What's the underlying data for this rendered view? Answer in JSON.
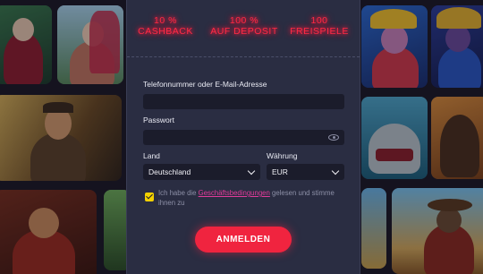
{
  "bonuses": [
    {
      "value": "10 %",
      "label": "CASHBACK"
    },
    {
      "value": "100 %",
      "label": "AUF DEPOSIT"
    },
    {
      "value": "100",
      "label": "FREISPIELE"
    }
  ],
  "form": {
    "contact_label": "Telefonnummer oder E-Mail-Adresse",
    "contact_value": "",
    "password_label": "Passwort",
    "password_value": "",
    "country_label": "Land",
    "country_value": "Deutschland",
    "currency_label": "Währung",
    "currency_value": "EUR",
    "terms_prefix": "Ich habe die ",
    "terms_link": "Geschäftsbedingungen",
    "terms_suffix": " gelesen und stimme ihnen zu",
    "terms_checked": true,
    "submit_label": "ANMELDEN"
  },
  "colors": {
    "accent": "#f0243f",
    "panel": "#2a2d42",
    "link": "#e23b9a",
    "checkbox": "#f3d100"
  },
  "icons": {
    "password_toggle": "eye-icon",
    "select": "chevron-down-icon",
    "checkbox": "checkmark-icon"
  }
}
